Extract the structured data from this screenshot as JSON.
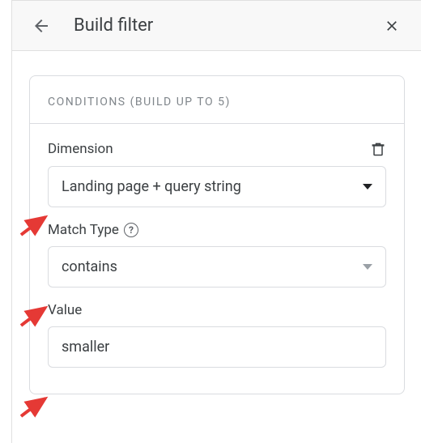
{
  "header": {
    "title": "Build filter"
  },
  "card": {
    "header_text": "CONDITIONS (BUILD UP TO 5)"
  },
  "fields": {
    "dimension": {
      "label": "Dimension",
      "selected": "Landing page + query string"
    },
    "match_type": {
      "label": "Match Type",
      "selected": "contains"
    },
    "value": {
      "label": "Value",
      "text": "smaller"
    }
  }
}
